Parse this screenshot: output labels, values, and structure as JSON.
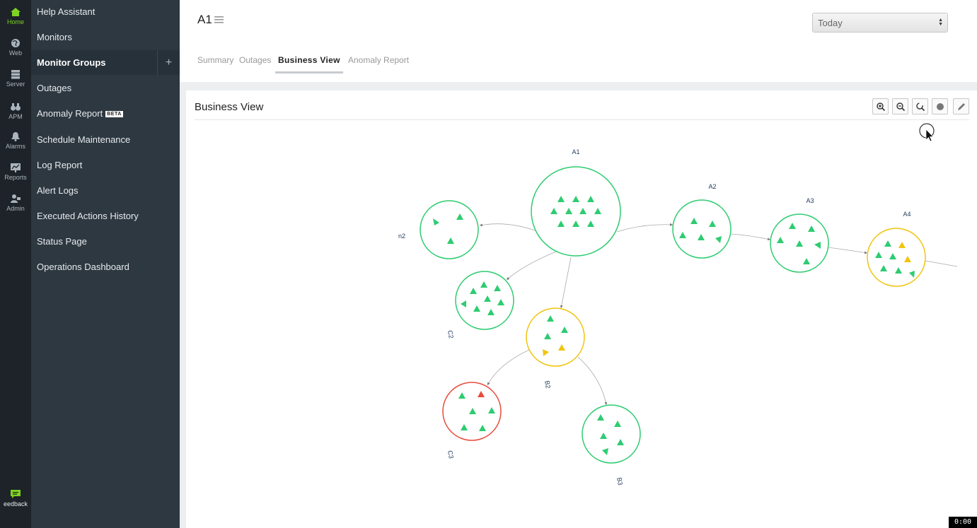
{
  "rail": {
    "items": [
      {
        "label": "Home",
        "icon": "home-icon",
        "active": true
      },
      {
        "label": "Web",
        "icon": "globe-icon"
      },
      {
        "label": "Server",
        "icon": "server-icon"
      },
      {
        "label": "APM",
        "icon": "binoculars-icon"
      },
      {
        "label": "Alarms",
        "icon": "bell-icon"
      },
      {
        "label": "Reports",
        "icon": "chart-icon"
      },
      {
        "label": "Admin",
        "icon": "admin-icon"
      }
    ],
    "feedback": "eedback"
  },
  "nav": {
    "items": [
      {
        "label": "Help Assistant"
      },
      {
        "label": "Monitors"
      },
      {
        "label": "Monitor Groups",
        "active": true
      },
      {
        "label": "Outages"
      },
      {
        "label": "Anomaly Report",
        "badge": "BETA"
      },
      {
        "label": "Schedule Maintenance"
      },
      {
        "label": "Log Report"
      },
      {
        "label": "Alert Logs"
      },
      {
        "label": "Executed Actions History"
      },
      {
        "label": "Status Page"
      },
      {
        "label": "Operations Dashboard"
      }
    ],
    "add_symbol": "+"
  },
  "header": {
    "title": "A1",
    "range": {
      "value": "Today"
    }
  },
  "tabs": [
    {
      "label": "Summary"
    },
    {
      "label": "Outages"
    },
    {
      "label": "Business View",
      "active": true
    },
    {
      "label": "Anomaly Report"
    }
  ],
  "business_view": {
    "title": "Business View",
    "tools": [
      "zoom-in-icon",
      "zoom-out-icon",
      "reset-zoom-icon",
      "record-icon",
      "edit-icon"
    ],
    "colors": {
      "up": "#2ecc71",
      "trouble": "#f1c40f",
      "down": "#e74c3c"
    },
    "nodes": [
      {
        "id": "A1",
        "label": "A1",
        "status": "up"
      },
      {
        "id": "n2",
        "label": "n2",
        "status": "up"
      },
      {
        "id": "C2",
        "label": "C2",
        "status": "up"
      },
      {
        "id": "B2",
        "label": "B2",
        "status": "trouble"
      },
      {
        "id": "C3",
        "label": "C3",
        "status": "down"
      },
      {
        "id": "B3",
        "label": "B3",
        "status": "up"
      },
      {
        "id": "A2",
        "label": "A2",
        "status": "up"
      },
      {
        "id": "A3",
        "label": "A3",
        "status": "up"
      },
      {
        "id": "A4",
        "label": "A4",
        "status": "trouble"
      }
    ]
  },
  "timer": "0:00"
}
